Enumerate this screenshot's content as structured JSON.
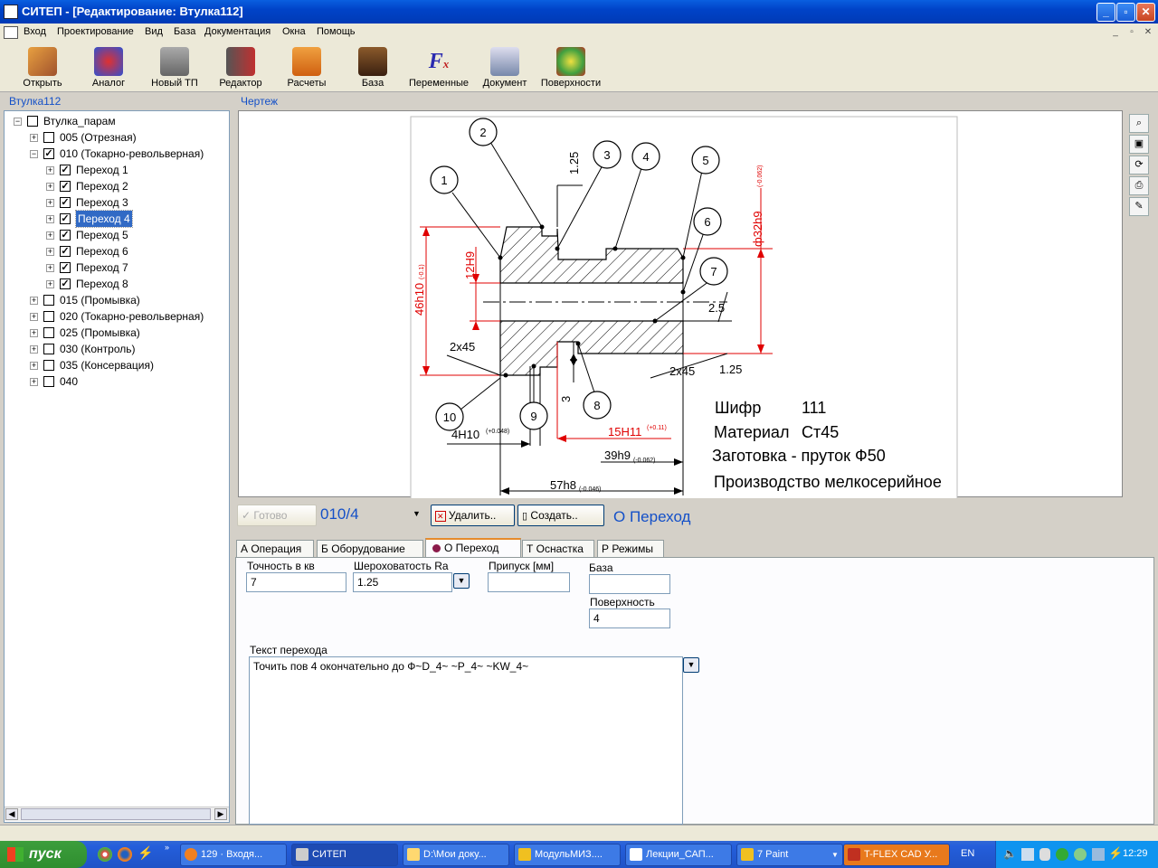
{
  "window": {
    "title": "СИТЕП - [Редактирование: Втулка112]"
  },
  "menu": [
    "Вход",
    "Проектирование",
    "Вид",
    "База",
    "Документация",
    "Окна",
    "Помощь"
  ],
  "toolbar": [
    "Открыть",
    "Аналог",
    "Новый ТП",
    "Редактор",
    "Расчеты",
    "База",
    "Переменные",
    "Документ",
    "Поверхности"
  ],
  "left": {
    "label": "Втулка112"
  },
  "tree": [
    {
      "label": "Втулка_парам",
      "level": 0,
      "exp": "−",
      "checked": false
    },
    {
      "label": "005 (Отрезная)",
      "level": 1,
      "exp": "+",
      "checked": false
    },
    {
      "label": "010 (Токарно-револьверная)",
      "level": 1,
      "exp": "−",
      "checked": true
    },
    {
      "label": "Переход 1",
      "level": 2,
      "exp": "+",
      "checked": true
    },
    {
      "label": "Переход 2",
      "level": 2,
      "exp": "+",
      "checked": true
    },
    {
      "label": "Переход 3",
      "level": 2,
      "exp": "+",
      "checked": true
    },
    {
      "label": "Переход 4",
      "level": 2,
      "exp": "+",
      "checked": true,
      "selected": true
    },
    {
      "label": "Переход 5",
      "level": 2,
      "exp": "+",
      "checked": true
    },
    {
      "label": "Переход 6",
      "level": 2,
      "exp": "+",
      "checked": true
    },
    {
      "label": "Переход 7",
      "level": 2,
      "exp": "+",
      "checked": true
    },
    {
      "label": "Переход 8",
      "level": 2,
      "exp": "+",
      "checked": true
    },
    {
      "label": "015 (Промывка)",
      "level": 1,
      "exp": "+",
      "checked": false
    },
    {
      "label": "020 (Токарно-револьверная)",
      "level": 1,
      "exp": "+",
      "checked": false
    },
    {
      "label": "025 (Промывка)",
      "level": 1,
      "exp": "+",
      "checked": false
    },
    {
      "label": "030 (Контроль)",
      "level": 1,
      "exp": "+",
      "checked": false
    },
    {
      "label": "035 (Консервация)",
      "level": 1,
      "exp": "+",
      "checked": false
    },
    {
      "label": "040",
      "level": 1,
      "exp": "+",
      "checked": false
    }
  ],
  "drawing": {
    "label": "Чертеж",
    "callouts": [
      "1",
      "2",
      "3",
      "4",
      "5",
      "6",
      "7",
      "8",
      "9",
      "10"
    ],
    "dims": {
      "d1": "1.25",
      "d2": "ф32h9",
      "d2t": "(-0.062)",
      "d3": "12Н9",
      "d4": "46h10",
      "d4t": "(-0.1)",
      "d5": "2.5",
      "d6": "2x45",
      "d7": "2x45",
      "d8": "1.25",
      "d9": "3",
      "d10": "4Н10",
      "d10t": "(+0.048)",
      "d11": "15Н11",
      "d11t": "(+0.11)",
      "d12": "39h9",
      "d12t": "(-0.062)",
      "d13": "57h8",
      "d13t": "(-0.046)"
    },
    "info": {
      "shifr_label": "Шифр",
      "shifr_value": "111",
      "mat_label": "Материал",
      "mat_value": "Ст45",
      "zag": "Заготовка - пруток Ф50",
      "prod": "Производство мелкосерийное"
    }
  },
  "controls": {
    "ready": "Готово",
    "code": "010/4",
    "delete": "Удалить..",
    "create": "Создать..",
    "heading": "О Переход"
  },
  "tabs": [
    "А Операция",
    "Б Оборудование",
    "О Переход",
    "Т Оснастка",
    "Р Режимы"
  ],
  "form": {
    "accuracy_label": "Точность в кв",
    "accuracy": "7",
    "rough_label": "Шероховатость Ra",
    "rough": "1.25",
    "allow_label": "Припуск [мм]",
    "allow": "",
    "base_label": "База",
    "base": "",
    "surface_label": "Поверхность",
    "surface": "4",
    "text_label": "Текст перехода",
    "text": "Точить пов 4  окончательно до Ф~D_4~ ~P_4~ ~KW_4~"
  },
  "taskbar": {
    "start": "пуск",
    "tasks": [
      "129 · Входя...",
      "СИТЕП",
      "D:\\Мои доку...",
      "МодульМИЗ....",
      "Лекции_САП...",
      "7 Paint",
      "T-FLEX CAD У..."
    ],
    "lang": "EN",
    "clock": "12:29"
  }
}
